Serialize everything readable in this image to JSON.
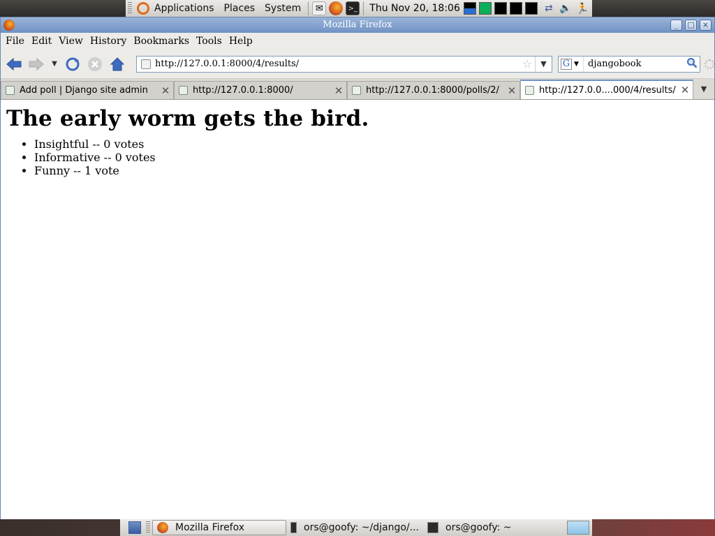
{
  "top_panel": {
    "menus": [
      "Applications",
      "Places",
      "System"
    ],
    "clock": "Thu Nov 20, 18:06",
    "launchers": [
      "mail-icon",
      "firefox-icon",
      "terminal-icon"
    ]
  },
  "window": {
    "title": "Mozilla Firefox"
  },
  "menubar": {
    "items": [
      "File",
      "Edit",
      "View",
      "History",
      "Bookmarks",
      "Tools",
      "Help"
    ]
  },
  "navbar": {
    "url": "http://127.0.0.1:8000/4/results/",
    "search_value": "djangobook"
  },
  "tabs": [
    {
      "title": "Add poll | Django site admin",
      "active": false
    },
    {
      "title": "http://127.0.0.1:8000/",
      "active": false
    },
    {
      "title": "http://127.0.0.1:8000/polls/2/",
      "active": false
    },
    {
      "title": "http://127.0.0....000/4/results/",
      "active": true
    }
  ],
  "page": {
    "heading": "The early worm gets the bird.",
    "results": [
      "Insightful -- 0 votes",
      "Informative -- 0 votes",
      "Funny -- 1 vote"
    ]
  },
  "bottom_panel": {
    "tasks": [
      "Mozilla Firefox",
      "ors@goofy: ~/django/...",
      "ors@goofy: ~"
    ]
  },
  "colors": {
    "titlebar": "#6f92c4",
    "panel": "#ecebe8"
  }
}
